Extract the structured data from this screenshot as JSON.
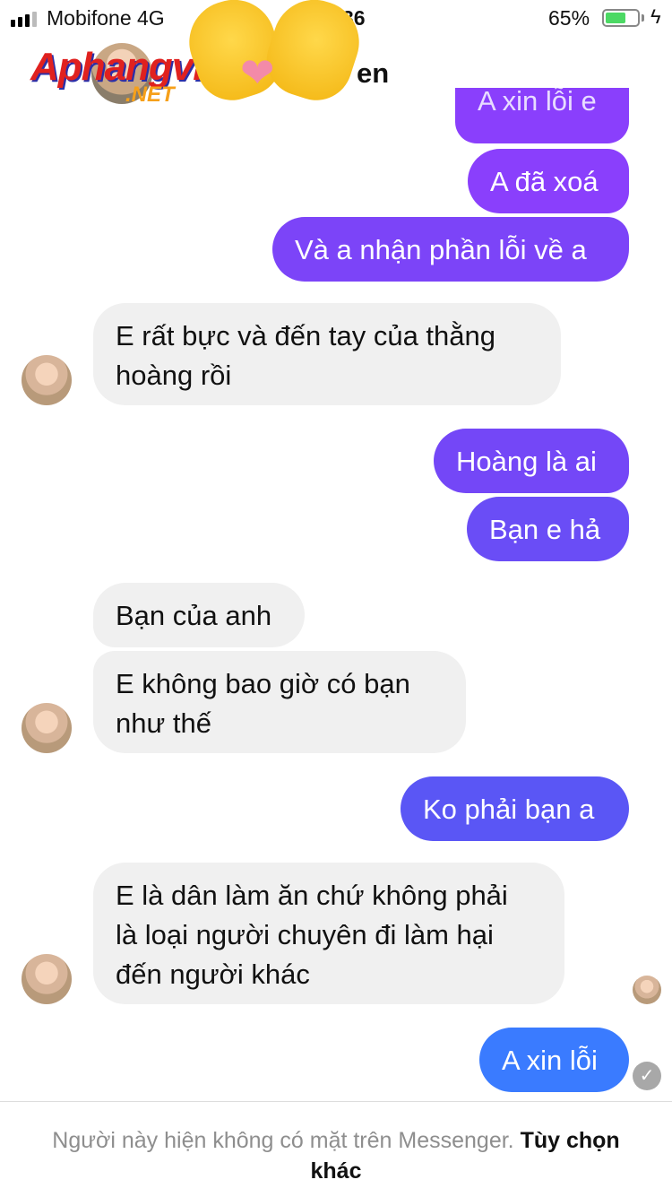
{
  "status_bar": {
    "carrier": "Mobifone  4G",
    "time": "36",
    "battery": "65%",
    "battery_level": 0.65
  },
  "header": {
    "contact_name": "en",
    "watermark": "Aphangvn",
    "watermark_sub": ".NET"
  },
  "colors": {
    "outgoing_purple": "#8a3ffc",
    "outgoing_blue": "#3a7bff",
    "incoming": "#f0f0f0"
  },
  "messages": [
    {
      "dir": "out",
      "text": "A xin lỗi e"
    },
    {
      "dir": "out",
      "text": "A đã xoá"
    },
    {
      "dir": "out",
      "text": "Và a nhận phần lỗi về a"
    },
    {
      "dir": "in",
      "text": "E rất bực và đến tay của thằng\nhoàng rồi"
    },
    {
      "dir": "out",
      "text": "Hoàng là ai"
    },
    {
      "dir": "out",
      "text": "Bạn e hả"
    },
    {
      "dir": "in",
      "text": "Bạn của anh"
    },
    {
      "dir": "in",
      "text": "E không bao giờ có bạn\nnhư thế"
    },
    {
      "dir": "out",
      "text": "Ko phải bạn a"
    },
    {
      "dir": "in",
      "text": "E là dân làm ăn chứ không phải\nlà loại người chuyên đi làm hại\nđến người khác"
    },
    {
      "dir": "out",
      "text": "A xin lỗi"
    }
  ],
  "footer": {
    "message": "Người này hiện không có mặt trên Messenger.",
    "link": "Tùy chọn khác"
  }
}
